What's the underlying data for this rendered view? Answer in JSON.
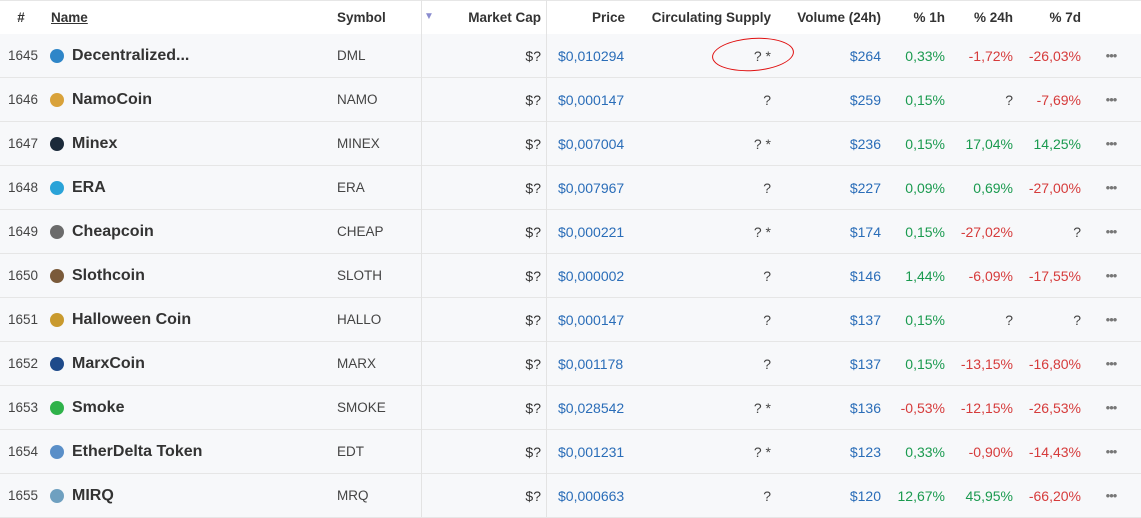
{
  "headers": {
    "rank": "#",
    "name": "Name",
    "symbol": "Symbol",
    "market_cap": "Market Cap",
    "price": "Price",
    "circulating_supply": "Circulating Supply",
    "volume": "Volume (24h)",
    "h1": "% 1h",
    "h24": "% 24h",
    "d7": "% 7d",
    "sort_indicator": "▼"
  },
  "rows": [
    {
      "rank": "1645",
      "name": "Decentralized...",
      "symbol": "DML",
      "market_cap": "$?",
      "price": "$0,010294",
      "supply": "? *",
      "volume": "$264",
      "h1": "0,33%",
      "h1_trend": "pos",
      "h24": "-1,72%",
      "h24_trend": "neg",
      "d7": "-26,03%",
      "d7_trend": "neg",
      "icon": "decentralized-icon",
      "icon_color": "#2f86c8",
      "more": "•••"
    },
    {
      "rank": "1646",
      "name": "NamoCoin",
      "symbol": "NAMO",
      "market_cap": "$?",
      "price": "$0,000147",
      "supply": "?",
      "volume": "$259",
      "h1": "0,15%",
      "h1_trend": "pos",
      "h24": "?",
      "h24_trend": "neu",
      "d7": "-7,69%",
      "d7_trend": "neg",
      "icon": "namocoin-icon",
      "icon_color": "#d9a23a",
      "more": "•••"
    },
    {
      "rank": "1647",
      "name": "Minex",
      "symbol": "MINEX",
      "market_cap": "$?",
      "price": "$0,007004",
      "supply": "? *",
      "volume": "$236",
      "h1": "0,15%",
      "h1_trend": "pos",
      "h24": "17,04%",
      "h24_trend": "pos",
      "d7": "14,25%",
      "d7_trend": "pos",
      "icon": "minex-icon",
      "icon_color": "#1b2a3a",
      "more": "•••"
    },
    {
      "rank": "1648",
      "name": "ERA",
      "symbol": "ERA",
      "market_cap": "$?",
      "price": "$0,007967",
      "supply": "?",
      "volume": "$227",
      "h1": "0,09%",
      "h1_trend": "pos",
      "h24": "0,69%",
      "h24_trend": "pos",
      "d7": "-27,00%",
      "d7_trend": "neg",
      "icon": "era-icon",
      "icon_color": "#2aa3d8",
      "more": "•••"
    },
    {
      "rank": "1649",
      "name": "Cheapcoin",
      "symbol": "CHEAP",
      "market_cap": "$?",
      "price": "$0,000221",
      "supply": "? *",
      "volume": "$174",
      "h1": "0,15%",
      "h1_trend": "pos",
      "h24": "-27,02%",
      "h24_trend": "neg",
      "d7": "?",
      "d7_trend": "neu",
      "icon": "cheapcoin-icon",
      "icon_color": "#6b6b6b",
      "more": "•••"
    },
    {
      "rank": "1650",
      "name": "Slothcoin",
      "symbol": "SLOTH",
      "market_cap": "$?",
      "price": "$0,000002",
      "supply": "?",
      "volume": "$146",
      "h1": "1,44%",
      "h1_trend": "pos",
      "h24": "-6,09%",
      "h24_trend": "neg",
      "d7": "-17,55%",
      "d7_trend": "neg",
      "icon": "slothcoin-icon",
      "icon_color": "#7a5a3a",
      "more": "•••"
    },
    {
      "rank": "1651",
      "name": "Halloween Coin",
      "symbol": "HALLO",
      "market_cap": "$?",
      "price": "$0,000147",
      "supply": "?",
      "volume": "$137",
      "h1": "0,15%",
      "h1_trend": "pos",
      "h24": "?",
      "h24_trend": "neu",
      "d7": "?",
      "d7_trend": "neu",
      "icon": "halloween-coin-icon",
      "icon_color": "#c99a2e",
      "more": "•••"
    },
    {
      "rank": "1652",
      "name": "MarxCoin",
      "symbol": "MARX",
      "market_cap": "$?",
      "price": "$0,001178",
      "supply": "?",
      "volume": "$137",
      "h1": "0,15%",
      "h1_trend": "pos",
      "h24": "-13,15%",
      "h24_trend": "neg",
      "d7": "-16,80%",
      "d7_trend": "neg",
      "icon": "marxcoin-icon",
      "icon_color": "#1e4a8a",
      "more": "•••"
    },
    {
      "rank": "1653",
      "name": "Smoke",
      "symbol": "SMOKE",
      "market_cap": "$?",
      "price": "$0,028542",
      "supply": "? *",
      "volume": "$136",
      "h1": "-0,53%",
      "h1_trend": "neg",
      "h24": "-12,15%",
      "h24_trend": "neg",
      "d7": "-26,53%",
      "d7_trend": "neg",
      "icon": "smoke-icon",
      "icon_color": "#2fb24a",
      "more": "•••"
    },
    {
      "rank": "1654",
      "name": "EtherDelta Token",
      "symbol": "EDT",
      "market_cap": "$?",
      "price": "$0,001231",
      "supply": "? *",
      "volume": "$123",
      "h1": "0,33%",
      "h1_trend": "pos",
      "h24": "-0,90%",
      "h24_trend": "neg",
      "d7": "-14,43%",
      "d7_trend": "neg",
      "icon": "etherdelta-icon",
      "icon_color": "#5a8fc8",
      "more": "•••"
    },
    {
      "rank": "1655",
      "name": "MIRQ",
      "symbol": "MRQ",
      "market_cap": "$?",
      "price": "$0,000663",
      "supply": "?",
      "volume": "$120",
      "h1": "12,67%",
      "h1_trend": "pos",
      "h24": "45,95%",
      "h24_trend": "pos",
      "d7": "-66,20%",
      "d7_trend": "neg",
      "icon": "mirq-icon",
      "icon_color": "#6fa0c0",
      "more": "•••"
    }
  ],
  "colors": {
    "positive": "#1a9a4f",
    "negative": "#d63b3b",
    "link_blue": "#2a6db8",
    "annotation_red": "#e01010"
  }
}
